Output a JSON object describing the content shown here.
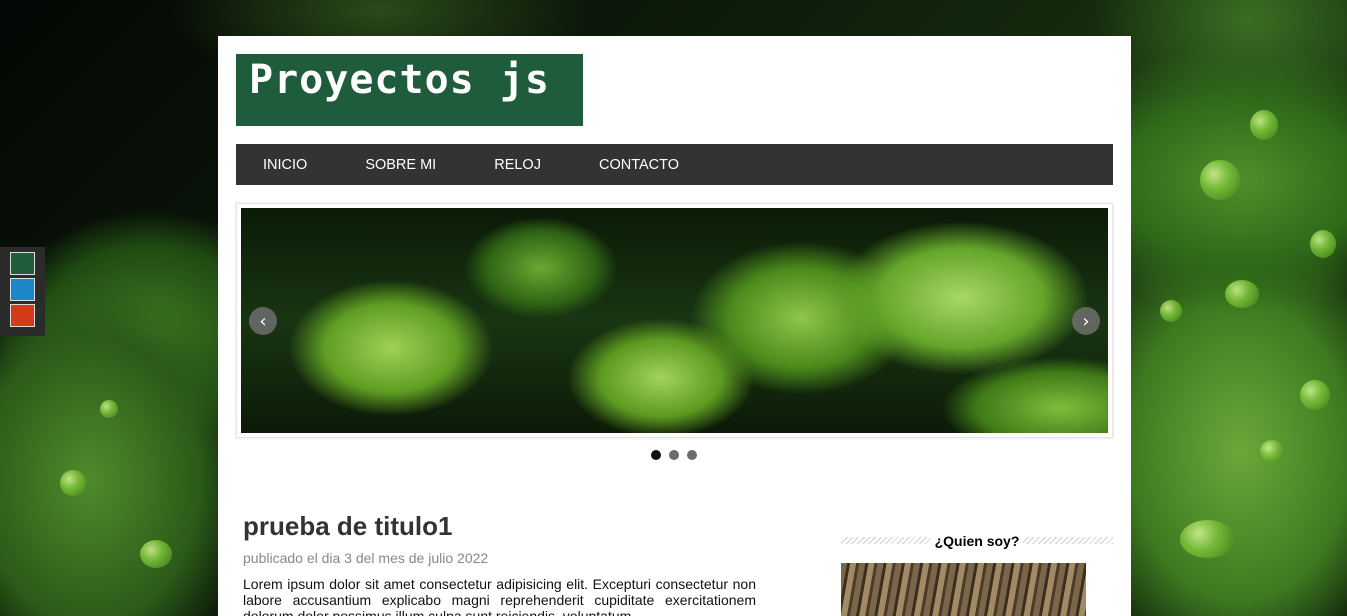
{
  "site": {
    "logo_text": "Proyectos js"
  },
  "nav": {
    "items": [
      "INICIO",
      "SOBRE MI",
      "RELOJ",
      "CONTACTO"
    ]
  },
  "color_switcher": {
    "colors": [
      "#1f5c3c",
      "#1b87c9",
      "#d23c1a"
    ]
  },
  "slider": {
    "prev_icon": "chevron-left-icon",
    "next_icon": "chevron-right-icon",
    "slide_count": 3,
    "active_index": 0
  },
  "post": {
    "title": "prueba de titulo1",
    "meta": "publicado el dia 3 del mes de julio 2022",
    "body": "Lorem ipsum dolor sit amet consectetur adipisicing elit. Excepturi consectetur non labore accusantium explicabo magni reprehenderit cupiditate exercitationem dolorum dolor possimus illum culpa sunt reiciendis, voluptatum"
  },
  "sidebar": {
    "widget_title": "¿Quien soy?"
  }
}
